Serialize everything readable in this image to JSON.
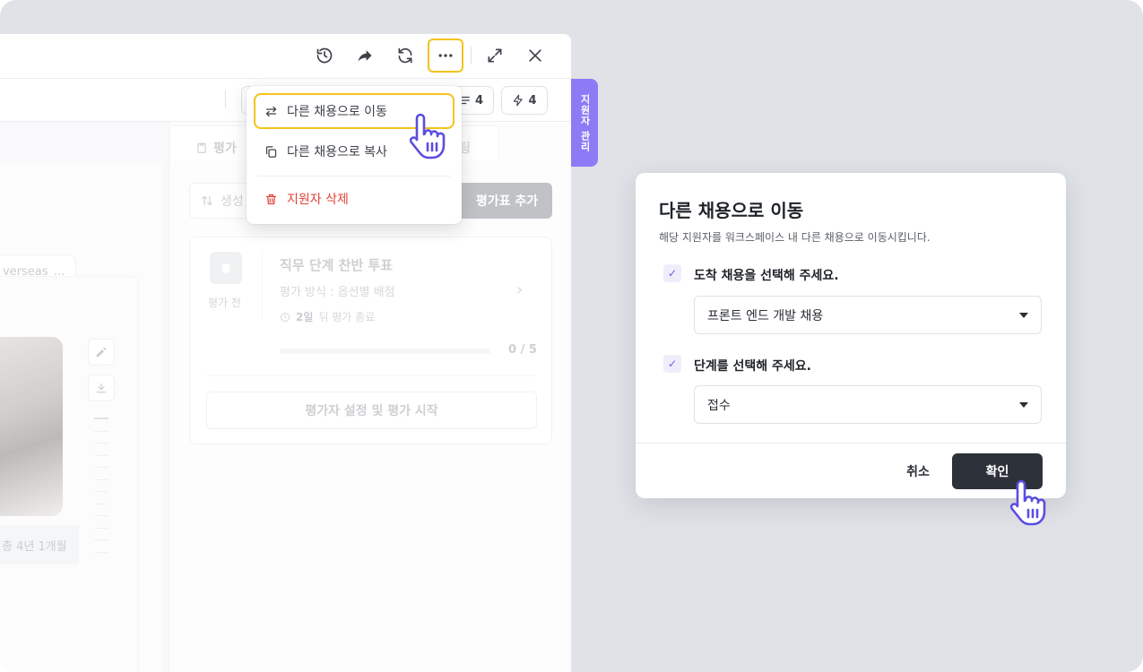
{
  "toolbar": {
    "icons": [
      "history-icon",
      "share-icon",
      "refresh-icon",
      "more-icon",
      "expand-icon",
      "close-icon"
    ]
  },
  "subbar": {
    "chip_comments": "4",
    "chip_actions": "4"
  },
  "side_tab": {
    "label": "지원자 관리"
  },
  "left_panel": {
    "field_value": "verseas_...",
    "career": "총 4년 1개월"
  },
  "evaluation": {
    "tab_label": "평가",
    "tab_other": "팅",
    "sort_label": "생성",
    "add_button": "평가표 추가",
    "status": "평가 전",
    "title": "직무 단계 찬반 투표",
    "method": "평가 방식 : 옵션별 배점",
    "due_days": "2일",
    "due_suffix": "뒤 평가 종료",
    "progress": 0,
    "progress_text": "0 / 5",
    "start_button": "평가자 설정 및 평가 시작"
  },
  "menu": {
    "items": [
      {
        "label": "다른 채용으로 이동",
        "icon": "swap-icon"
      },
      {
        "label": "다른 채용으로 복사",
        "icon": "copy-icon"
      },
      {
        "label": "지원자 삭제",
        "icon": "trash-icon"
      }
    ]
  },
  "modal": {
    "title": "다른 채용으로 이동",
    "description": "해당 지원자를 워크스페이스 내 다른 채용으로 이동시킵니다.",
    "q1": "도착 채용을 선택해 주세요.",
    "q1_value": "프론트 엔드 개발 채용",
    "q2": "단계를 선택해 주세요.",
    "q2_value": "접수",
    "cancel": "취소",
    "confirm": "확인"
  },
  "colors": {
    "accent": "#8b7cf6",
    "highlight": "#f4c319",
    "danger": "#e0443a",
    "primary_button": "#2d313a"
  }
}
